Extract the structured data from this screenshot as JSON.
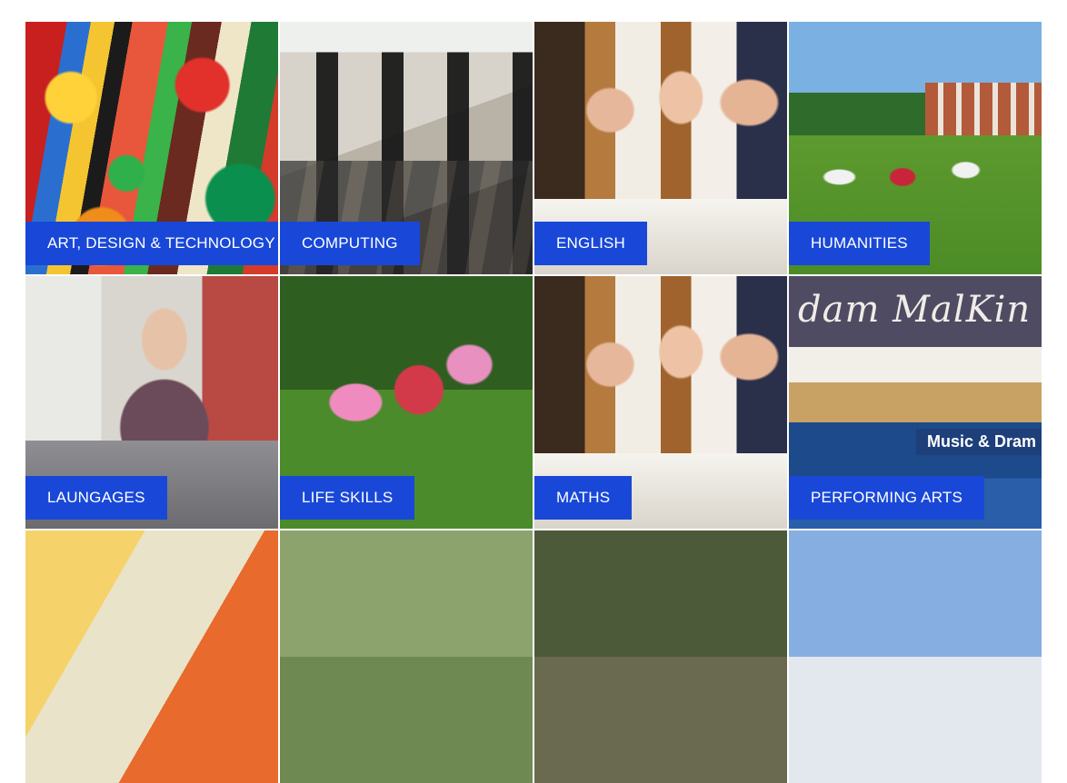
{
  "subjects": [
    {
      "label": "ART, DESIGN & TECHNOLOGY"
    },
    {
      "label": "COMPUTING"
    },
    {
      "label": "ENGLISH"
    },
    {
      "label": "HUMANITIES"
    },
    {
      "label": "LAUNGAGES"
    },
    {
      "label": "LIFE SKILLS"
    },
    {
      "label": "MATHS"
    },
    {
      "label": "PERFORMING ARTS"
    }
  ],
  "photo_text": {
    "sign": "dam MalKin",
    "banner": "Music & Dram"
  },
  "colors": {
    "label_background": "#1948d8",
    "label_text": "#ffffff"
  }
}
